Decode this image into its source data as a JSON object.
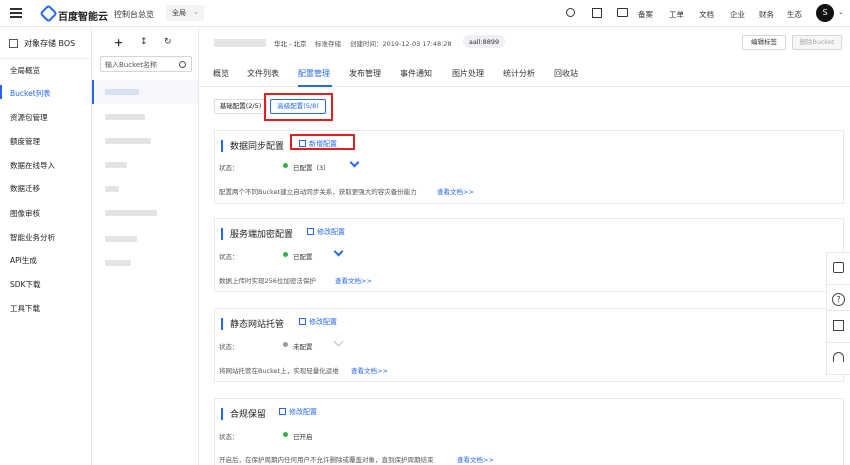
{
  "topbar": {
    "brand": "百度智能云",
    "console": "控制台总览",
    "region": "全局",
    "nav": [
      "备案",
      "工单",
      "文档",
      "企业",
      "财务",
      "生态"
    ],
    "avatar": "S"
  },
  "sidebar": {
    "title": "对象存储 BOS",
    "items": [
      {
        "label": "全局概览"
      },
      {
        "label": "Bucket列表"
      },
      {
        "label": "资源包管理"
      },
      {
        "label": "额度管理"
      },
      {
        "label": "数据在线导入"
      },
      {
        "label": "数据迁移"
      },
      {
        "label": "图像审核"
      },
      {
        "label": "智能业务分析"
      },
      {
        "label": "API生成"
      },
      {
        "label": "SDK下载"
      },
      {
        "label": "工具下载"
      }
    ]
  },
  "bucket_pane": {
    "toolbar": [
      "+",
      "↕",
      "↻"
    ],
    "search_placeholder": "输入Bucket名称"
  },
  "header": {
    "region": "华北 - 北京",
    "storage_class": "标准存储",
    "created": "创建时间：2019-12-03 17:48:28",
    "tag": "aall:8899",
    "edit_tags": "编辑标签",
    "delete_bucket": "删除Bucket"
  },
  "tabs": [
    "概览",
    "文件列表",
    "配置管理",
    "发布管理",
    "事件通知",
    "图片处理",
    "统计分析",
    "回收站"
  ],
  "config_tabs": [
    "基础配置(2/5)",
    "高级配置(5/8)"
  ],
  "cards": [
    {
      "title": "数据同步配置",
      "action": "新增配置",
      "status_label": "状态：",
      "status": "已配置（3）",
      "desc": "配置两个不同Bucket建立自动同步关系，获取更强大的容灾备份能力",
      "doc": "查看文档>>"
    },
    {
      "title": "服务端加密配置",
      "action": "修改配置",
      "status_label": "状态：",
      "status": "已配置",
      "desc": "数据上传时实现256位加密法保护",
      "doc": "查看文档>>"
    },
    {
      "title": "静态网站托管",
      "action": "修改配置",
      "status_label": "状态：",
      "status": "未配置",
      "desc": "将网站托管在Bucket上，实现轻量化运维",
      "doc": "查看文档>>"
    },
    {
      "title": "合规保留",
      "action": "修改配置",
      "status_label": "状态：",
      "status": "已开启",
      "desc": "开启后，在保护周期内任何用户不允许删除或覆盖对象，直到保护周期结束",
      "doc": "查看文档>>"
    }
  ],
  "colors": {
    "accent": "#2468f2",
    "success": "#2fb34a",
    "muted": "#9a9a9a",
    "highlight": "#e02020"
  }
}
